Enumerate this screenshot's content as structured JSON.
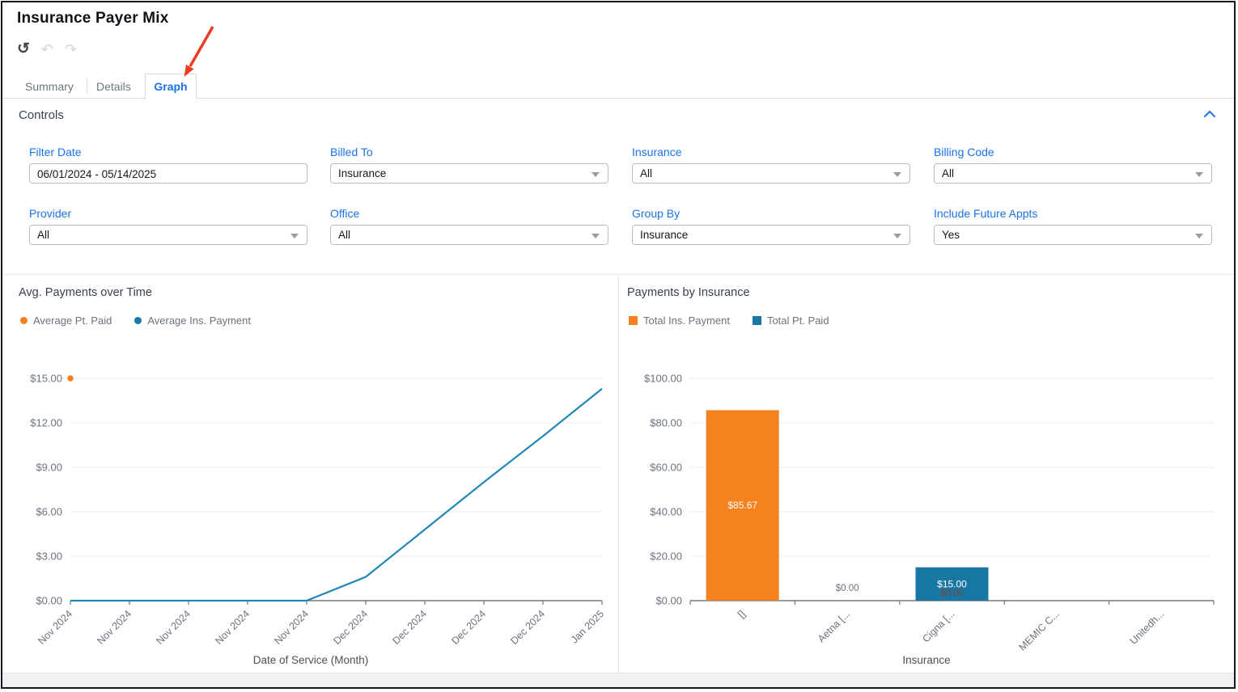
{
  "header": {
    "title": "Insurance Payer Mix"
  },
  "toolbar": {
    "refresh_icon": "↺",
    "undo_icon": "↶",
    "redo_icon": "↷"
  },
  "tabs": [
    {
      "label": "Summary",
      "active": false
    },
    {
      "label": "Details",
      "active": false
    },
    {
      "label": "Graph",
      "active": true
    }
  ],
  "controls": {
    "header": "Controls",
    "fields": [
      {
        "label": "Filter Date",
        "value": "06/01/2024 - 05/14/2025",
        "type": "daterange"
      },
      {
        "label": "Billed To",
        "value": "Insurance",
        "type": "select"
      },
      {
        "label": "Insurance",
        "value": "All",
        "type": "select"
      },
      {
        "label": "Billing Code",
        "value": "All",
        "type": "select"
      },
      {
        "label": "Provider",
        "value": "All",
        "type": "select"
      },
      {
        "label": "Office",
        "value": "All",
        "type": "select"
      },
      {
        "label": "Group By",
        "value": "Insurance",
        "type": "select"
      },
      {
        "label": "Include Future Appts",
        "value": "Yes",
        "type": "select"
      }
    ]
  },
  "colors": {
    "accent_blue": "#1a73e8",
    "orange": "#f5821e",
    "teal": "#1878a3",
    "teal_line": "#2187b5",
    "arrow_red": "#ee3b24",
    "axis_text": "#6b7280"
  },
  "chart_data": [
    {
      "type": "line",
      "title": "Avg. Payments over Time",
      "xlabel": "Date of Service (Month)",
      "ylabel": "",
      "x": [
        "Nov 2024",
        "Nov 2024",
        "Nov 2024",
        "Nov 2024",
        "Nov 2024",
        "Dec 2024",
        "Dec 2024",
        "Dec 2024",
        "Dec 2024",
        "Jan 2025"
      ],
      "ylim": [
        0,
        15
      ],
      "yticks": [
        "$0.00",
        "$3.00",
        "$6.00",
        "$9.00",
        "$12.00",
        "$15.00"
      ],
      "grid": true,
      "legend_position": "top-left",
      "series": [
        {
          "name": "Average Pt. Paid",
          "type": "scatter",
          "color": "#f5821e",
          "values": [
            15,
            null,
            null,
            null,
            null,
            null,
            null,
            null,
            null,
            null
          ]
        },
        {
          "name": "Average Ins. Payment",
          "type": "line",
          "color": "#2187b5",
          "values": [
            0,
            0,
            0,
            0,
            0,
            1.6,
            4.8,
            8.0,
            11.1,
            14.3
          ]
        }
      ]
    },
    {
      "type": "bar",
      "title": "Payments by Insurance",
      "xlabel": "Insurance",
      "ylabel": "",
      "categories": [
        "[]",
        "Aetna [...",
        "Cigna [...",
        "MEMIC C...",
        "Unitedh..."
      ],
      "ylim": [
        0,
        100
      ],
      "yticks": [
        "$0.00",
        "$20.00",
        "$40.00",
        "$60.00",
        "$80.00",
        "$100.00"
      ],
      "grid": true,
      "legend_position": "top-left",
      "series": [
        {
          "name": "Total Ins. Payment",
          "color": "#f5821e",
          "values": [
            85.67,
            0,
            0,
            0,
            0
          ]
        },
        {
          "name": "Total Pt. Paid",
          "color": "#1878a3",
          "values": [
            0,
            0,
            15,
            0,
            0
          ]
        }
      ],
      "bar_labels": [
        {
          "category": 0,
          "text": "$85.67",
          "placement": "bar-center"
        },
        {
          "category": 1,
          "text": "$0.00",
          "placement": "above-axis"
        },
        {
          "category": 2,
          "text": "$15.00",
          "placement": "bar-center"
        },
        {
          "category": 2,
          "text": "$0.00",
          "placement": "above-axis-dark"
        }
      ]
    }
  ]
}
